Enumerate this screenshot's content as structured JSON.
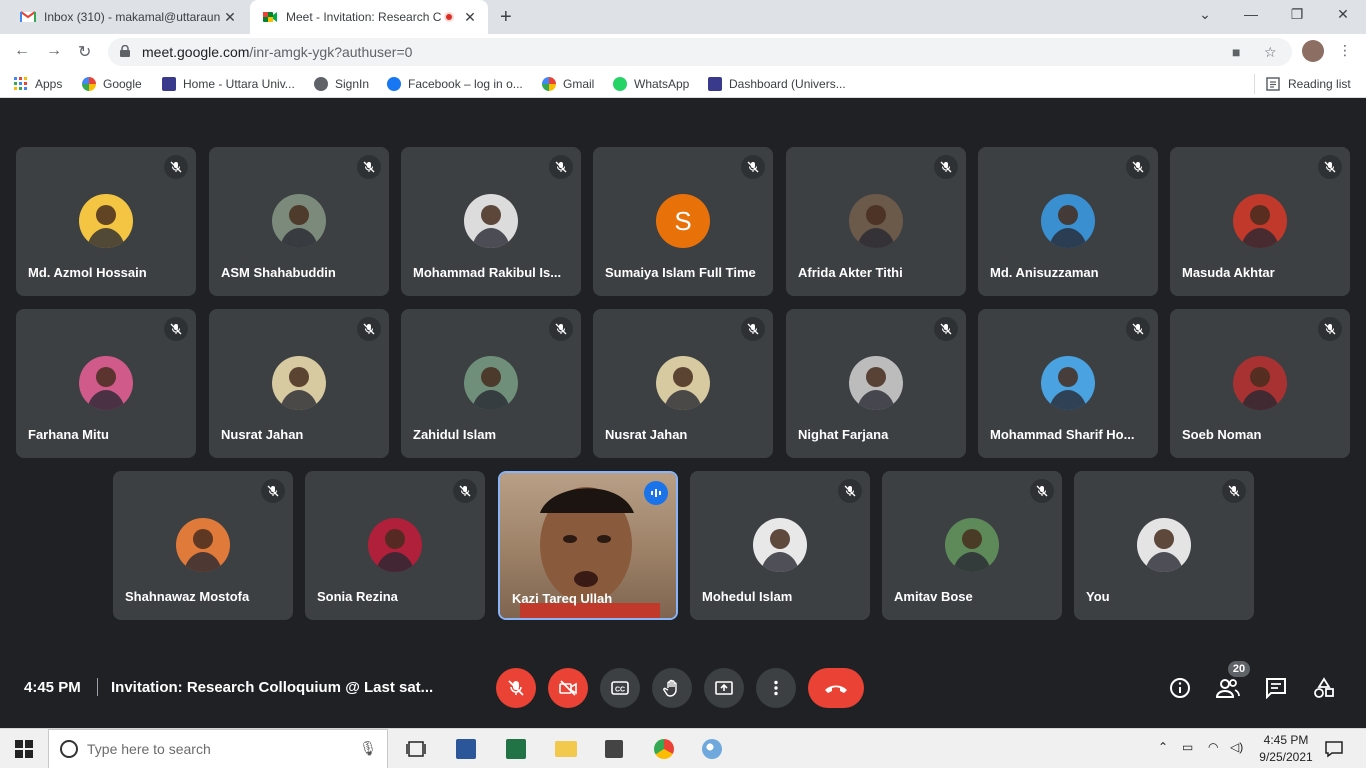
{
  "browser": {
    "tabs": [
      {
        "title": "Inbox (310) - makamal@uttaraun",
        "icon": "gmail-icon"
      },
      {
        "title": "Meet - Invitation: Research C",
        "icon": "meet-icon",
        "recording": true
      }
    ],
    "url_host": "meet.google.com",
    "url_path": "/inr-amgk-ygk?authuser=0",
    "bookmarks": [
      {
        "label": "Apps",
        "icon": "apps-grid-icon"
      },
      {
        "label": "Google",
        "icon": "google-icon"
      },
      {
        "label": "Home - Uttara Univ...",
        "icon": "university-icon"
      },
      {
        "label": "SignIn",
        "icon": "globe-icon"
      },
      {
        "label": "Facebook – log in o...",
        "icon": "facebook-icon"
      },
      {
        "label": "Gmail",
        "icon": "google-icon"
      },
      {
        "label": "WhatsApp",
        "icon": "whatsapp-icon"
      },
      {
        "label": "Dashboard (Univers...",
        "icon": "university-icon"
      }
    ],
    "reading_list": "Reading list"
  },
  "participants": [
    {
      "name": "Md. Azmol Hossain",
      "muted": true,
      "avatar_color": "#f4c542"
    },
    {
      "name": "ASM Shahabuddin",
      "muted": true,
      "avatar_color": "#7b8a7a"
    },
    {
      "name": "Mohammad Rakibul Is...",
      "muted": true,
      "avatar_color": "#dcdcdc"
    },
    {
      "name": "Sumaiya Islam Full Time",
      "muted": true,
      "initial": "S",
      "avatar_color": "#e8710a"
    },
    {
      "name": "Afrida Akter Tithi",
      "muted": true,
      "avatar_color": "#6b5a4a"
    },
    {
      "name": "Md. Anisuzzaman",
      "muted": true,
      "avatar_color": "#3a8fd1"
    },
    {
      "name": "Masuda Akhtar",
      "muted": true,
      "avatar_color": "#c0392b"
    },
    {
      "name": "Farhana Mitu",
      "muted": true,
      "avatar_color": "#d05a8a"
    },
    {
      "name": "Nusrat Jahan",
      "muted": true,
      "avatar_color": "#d7c9a0"
    },
    {
      "name": "Zahidul Islam",
      "muted": true,
      "avatar_color": "#6f8f7a"
    },
    {
      "name": "Nusrat Jahan",
      "muted": true,
      "avatar_color": "#d7c9a0"
    },
    {
      "name": "Nighat Farjana",
      "muted": true,
      "avatar_color": "#bcbcbc"
    },
    {
      "name": "Mohammad Sharif Ho...",
      "muted": true,
      "avatar_color": "#4aa3e0"
    },
    {
      "name": "Soeb Noman",
      "muted": true,
      "avatar_color": "#a83232"
    },
    {
      "name": "Shahnawaz Mostofa",
      "muted": true,
      "avatar_color": "#e07a3a"
    },
    {
      "name": "Sonia Rezina",
      "muted": true,
      "avatar_color": "#b0203a"
    },
    {
      "name": "Kazi Tareq Ullah",
      "muted": false,
      "speaking": true,
      "video": true
    },
    {
      "name": "Mohedul Islam",
      "muted": true,
      "avatar_color": "#e8e8e8"
    },
    {
      "name": "Amitav Bose",
      "muted": true,
      "avatar_color": "#5e8a5a"
    },
    {
      "name": "You",
      "muted": true,
      "avatar_color": "#e4e4e4"
    }
  ],
  "meeting": {
    "time": "4:45 PM",
    "title": "Invitation: Research Colloquium @ Last sat...",
    "participant_count": "20"
  },
  "taskbar": {
    "search_placeholder": "Type here to search",
    "time": "4:45 PM",
    "date": "9/25/2021"
  },
  "colors": {
    "meet_bg": "#202124",
    "tile_bg": "#3c4043",
    "danger": "#ea4335",
    "speaking": "#1a73e8"
  }
}
